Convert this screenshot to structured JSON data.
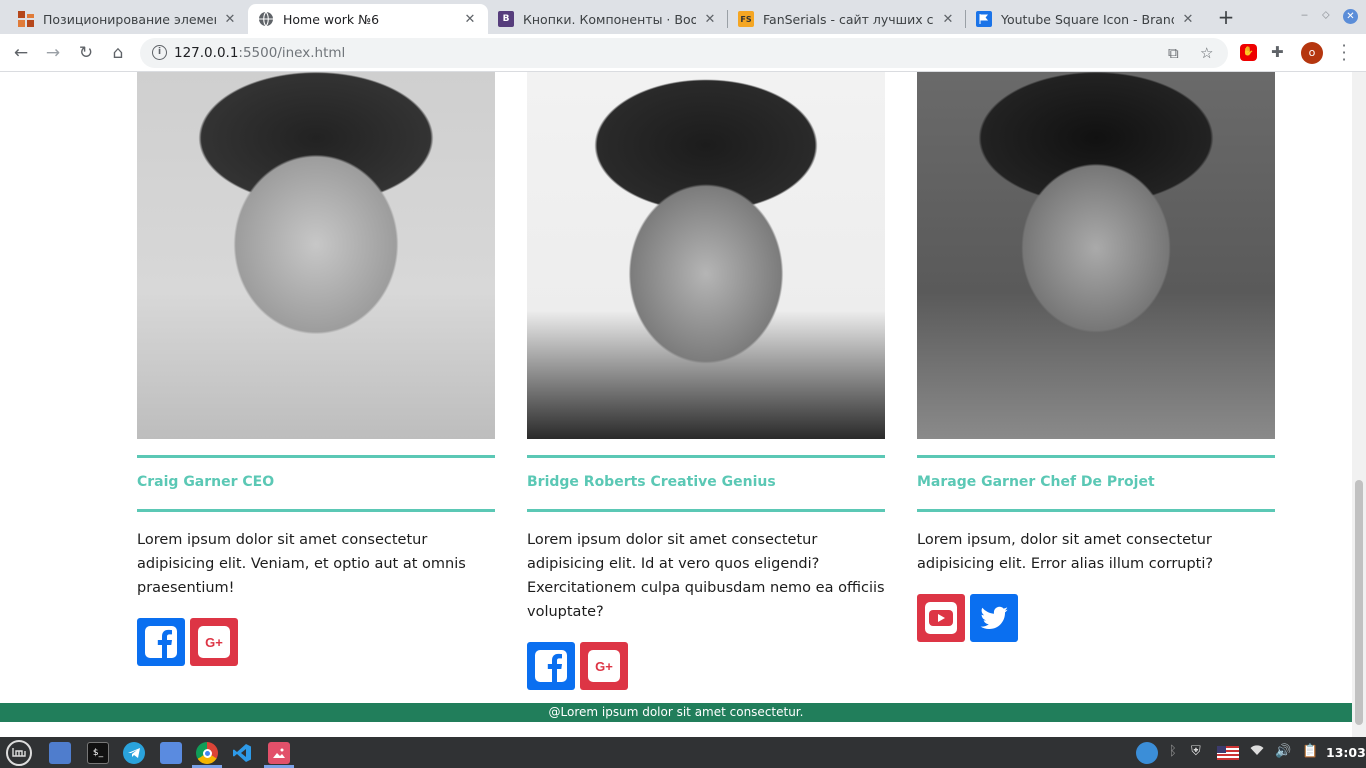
{
  "browser": {
    "tabs": [
      {
        "title": "Позиционирование элемен",
        "favicon": "squares-favicon",
        "active": false
      },
      {
        "title": "Home work №6",
        "favicon": "globe-favicon",
        "active": true
      },
      {
        "title": "Кнопки. Компоненты · Boot",
        "favicon": "bootstrap-favicon",
        "active": false
      },
      {
        "title": "FanSerials - сайт лучших сер",
        "favicon": "fs-favicon",
        "active": false
      },
      {
        "title": "Youtube Square Icon - Brands",
        "favicon": "flag-favicon",
        "active": false
      }
    ],
    "favicon_text": {
      "bootstrap": "B",
      "fs": "FS"
    },
    "close_glyph": "✕",
    "new_tab_glyph": "+",
    "url_host": "127.0.0.1",
    "url_rest": ":5500/inex.html",
    "profile_initial": "o"
  },
  "team": [
    {
      "name": "Craig Garner CEO",
      "description": "Lorem ipsum dolor sit amet consectetur adipisicing elit. Veniam, et optio aut at omnis praesentium!",
      "socials": [
        "facebook",
        "google-plus"
      ]
    },
    {
      "name": "Bridge Roberts Creative Genius",
      "description": "Lorem ipsum dolor sit amet consectetur adipisicing elit. Id at vero quos eligendi? Exercitationem culpa quibusdam nemo ea officiis voluptate?",
      "socials": [
        "facebook",
        "google-plus"
      ]
    },
    {
      "name": "Marage Garner Chef De Projet",
      "description": "Lorem ipsum, dolor sit amet consectetur adipisicing elit. Error alias illum corrupti?",
      "socials": [
        "youtube",
        "twitter"
      ]
    }
  ],
  "footer": {
    "text": "@Lorem ipsum dolor sit amet consectetur."
  },
  "taskbar": {
    "clock": "13:03",
    "terminal_label": "$_"
  },
  "colors": {
    "accent": "#5bc8b5",
    "footer": "#217e5b",
    "social_blue": "#0a6ff0",
    "social_red": "#dd3545"
  }
}
